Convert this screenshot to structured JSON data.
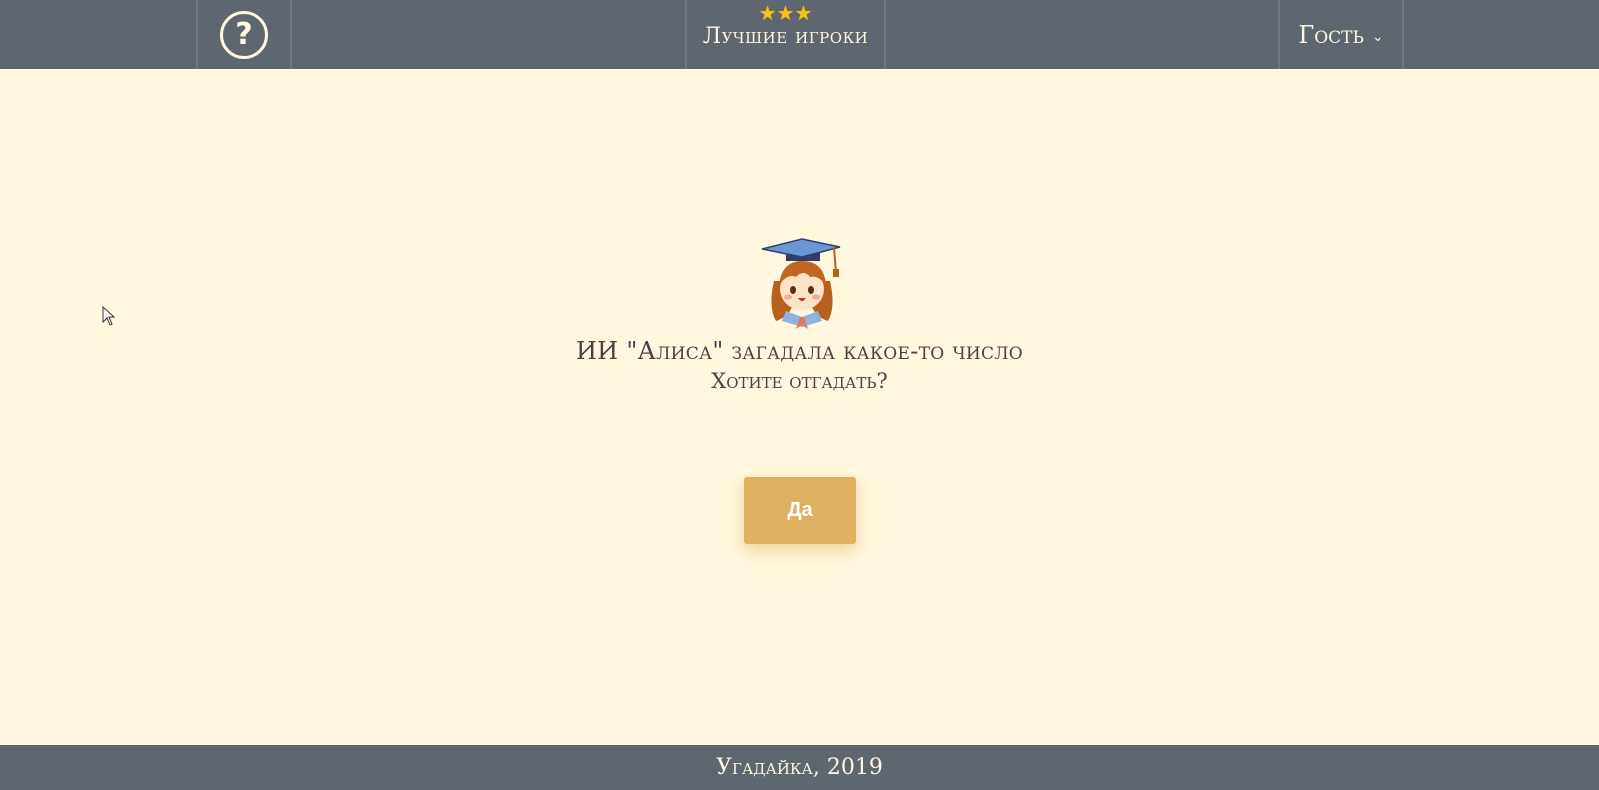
{
  "header": {
    "help_symbol": "?",
    "leaders_stars": [
      "★",
      "★",
      "★"
    ],
    "leaders_label": "Лучшие игроки",
    "user_label": "Гость",
    "user_chevron": "⌄"
  },
  "main": {
    "headline": "ИИ \"Алиса\" загадала какое-то число",
    "subline": "Хотите отгадать?",
    "yes_button": "Да"
  },
  "footer": {
    "text": "Угадайка, 2019"
  },
  "colors": {
    "background": "#fff8de",
    "bar": "#5e666f",
    "button": "#deb060",
    "text": "#4a3f4a",
    "star": "#f5c316"
  }
}
